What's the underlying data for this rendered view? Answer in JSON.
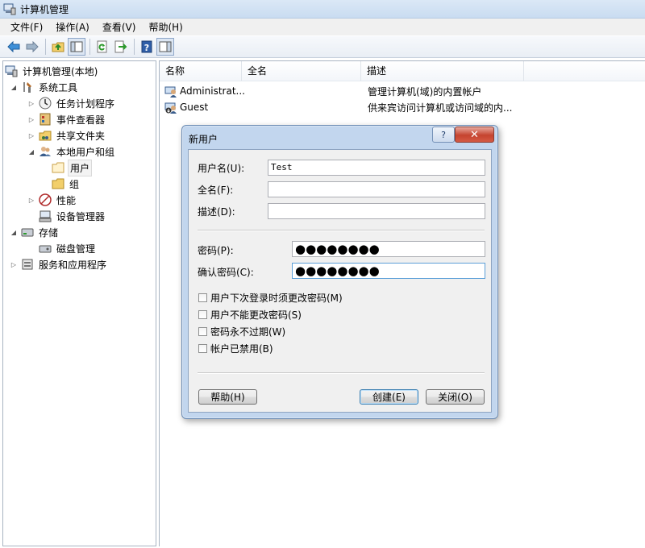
{
  "window": {
    "title": "计算机管理"
  },
  "menu": [
    "文件(F)",
    "操作(A)",
    "查看(V)",
    "帮助(H)"
  ],
  "toolbar": [
    "back-icon",
    "forward-icon",
    "up-folder-icon",
    "show-hide-tree-icon",
    "refresh-icon",
    "export-list-icon",
    "help-icon",
    "properties-icon"
  ],
  "tree": [
    {
      "label": "计算机管理(本地)",
      "icon": "computer-management-icon"
    },
    {
      "label": "系统工具",
      "icon": "system-tools-icon"
    },
    {
      "label": "任务计划程序",
      "icon": "task-scheduler-icon"
    },
    {
      "label": "事件查看器",
      "icon": "event-viewer-icon"
    },
    {
      "label": "共享文件夹",
      "icon": "shared-folders-icon"
    },
    {
      "label": "本地用户和组",
      "icon": "local-users-groups-icon"
    },
    {
      "label": "用户",
      "icon": "folder-icon"
    },
    {
      "label": "组",
      "icon": "folder-icon"
    },
    {
      "label": "性能",
      "icon": "performance-icon"
    },
    {
      "label": "设备管理器",
      "icon": "device-manager-icon"
    },
    {
      "label": "存储",
      "icon": "storage-icon"
    },
    {
      "label": "磁盘管理",
      "icon": "disk-management-icon"
    },
    {
      "label": "服务和应用程序",
      "icon": "services-apps-icon"
    }
  ],
  "list": {
    "columns": [
      "名称",
      "全名",
      "描述"
    ],
    "rows": [
      {
        "name": "Administrat...",
        "fullname": "",
        "description": "管理计算机(域)的内置帐户"
      },
      {
        "name": "Guest",
        "fullname": "",
        "description": "供来宾访问计算机或访问域的内..."
      }
    ]
  },
  "dialog": {
    "title": "新用户",
    "help_glyph": "?",
    "close_glyph": "✕",
    "fields": {
      "username_label": "用户名(U):",
      "username_value": "Test",
      "fullname_label": "全名(F):",
      "fullname_value": "",
      "description_label": "描述(D):",
      "description_value": "",
      "password_label": "密码(P):",
      "password_value": "●●●●●●●●",
      "confirm_label": "确认密码(C):",
      "confirm_value": "●●●●●●●●"
    },
    "checkboxes": [
      {
        "label": "用户下次登录时须更改密码(M)",
        "checked": false
      },
      {
        "label": "用户不能更改密码(S)",
        "checked": false
      },
      {
        "label": "密码永不过期(W)",
        "checked": false
      },
      {
        "label": "帐户已禁用(B)",
        "checked": false
      }
    ],
    "buttons": {
      "help": "帮助(H)",
      "create": "创建(E)",
      "close": "关闭(O)"
    }
  }
}
